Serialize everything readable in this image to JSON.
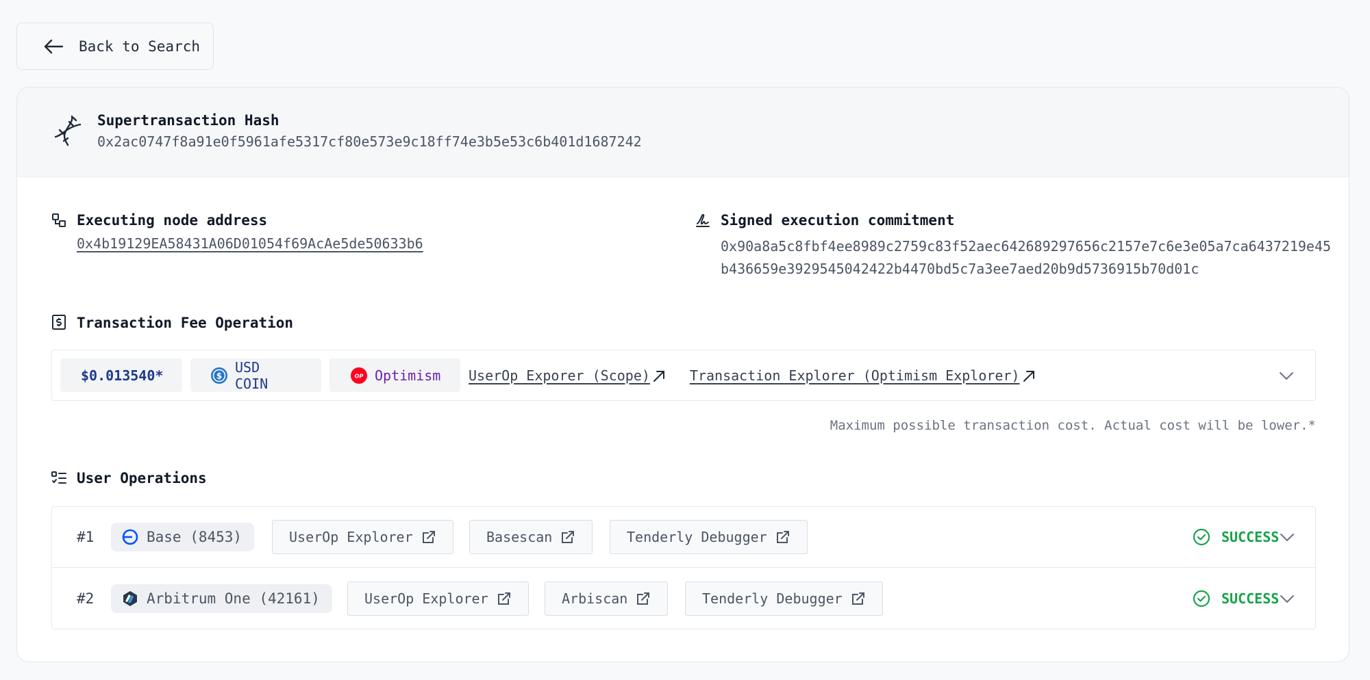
{
  "back": {
    "label": "Back to Search"
  },
  "header": {
    "title": "Supertransaction Hash",
    "hash": "0x2ac0747f8a91e0f5961afe5317cf80e573e9c18ff74e3b5e53c6b401d1687242"
  },
  "node": {
    "title": "Executing node address",
    "address": "0x4b19129EA58431A06D01054f69AcAe5de50633b6"
  },
  "commitment": {
    "title": "Signed execution commitment",
    "value": "0x90a8a5c8fbf4ee8989c2759c83f52aec642689297656c2157e7c6e3e05a7ca6437219e45b436659e3929545042422b4470bd5c7a3ee7aed20b9d5736915b70d01c"
  },
  "fee": {
    "title": "Transaction Fee Operation",
    "amount": "$0.013540*",
    "token": "USD COIN",
    "chain": "Optimism",
    "userop_link": "UserOp Exporer (Scope)",
    "tx_link": "Transaction Explorer (Optimism Explorer)",
    "note": "Maximum possible transaction cost. Actual cost will be lower.*"
  },
  "operations": {
    "title": "User Operations",
    "rows": [
      {
        "num": "#1",
        "chain": "Base (8453)",
        "chain_icon": "base-logo-icon",
        "btn1": "UserOp Explorer",
        "btn2": "Basescan",
        "btn3": "Tenderly Debugger",
        "status": "SUCCESS"
      },
      {
        "num": "#2",
        "chain": "Arbitrum One (42161)",
        "chain_icon": "arbitrum-logo-icon",
        "btn1": "UserOp Explorer",
        "btn2": "Arbiscan",
        "btn3": "Tenderly Debugger",
        "status": "SUCCESS"
      }
    ]
  },
  "colors": {
    "success": "#16a34a",
    "usdc": "#2775ca",
    "optimism": "#ff0420",
    "base": "#0052ff"
  }
}
